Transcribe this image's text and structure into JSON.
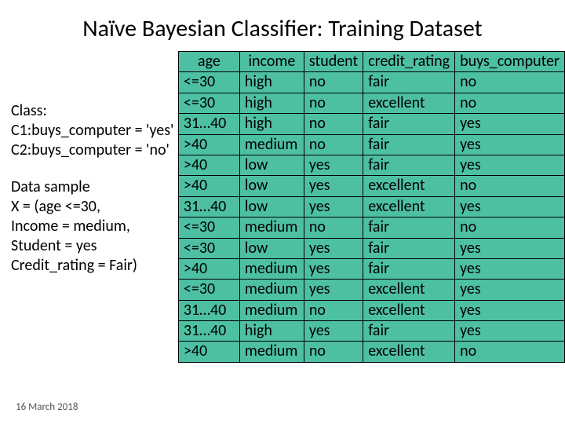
{
  "title": "Naïve Bayesian Classifier: Training Dataset",
  "left": {
    "class_heading": "Class:",
    "class_c1": "C1:buys_computer = 'yes'",
    "class_c2": "C2:buys_computer = 'no'",
    "sample_heading": "Data sample",
    "sample_l1": "X = (age <=30,",
    "sample_l2": "Income = medium,",
    "sample_l3": "Student = yes",
    "sample_l4": "Credit_rating = Fair)"
  },
  "date": "16 March 2018",
  "table": {
    "headers": {
      "age": "age",
      "income": "income",
      "student": "student",
      "credit": "credit_rating",
      "buys": "buys_computer"
    },
    "rows": [
      {
        "age": "<=30",
        "income": "high",
        "student": "no",
        "credit": "fair",
        "buys": "no"
      },
      {
        "age": "<=30",
        "income": "high",
        "student": "no",
        "credit": "excellent",
        "buys": "no"
      },
      {
        "age": "31…40",
        "income": "high",
        "student": "no",
        "credit": "fair",
        "buys": "yes"
      },
      {
        "age": ">40",
        "income": "medium",
        "student": "no",
        "credit": "fair",
        "buys": "yes"
      },
      {
        "age": ">40",
        "income": "low",
        "student": "yes",
        "credit": "fair",
        "buys": "yes"
      },
      {
        "age": ">40",
        "income": "low",
        "student": "yes",
        "credit": "excellent",
        "buys": "no"
      },
      {
        "age": "31…40",
        "income": "low",
        "student": "yes",
        "credit": "excellent",
        "buys": "yes"
      },
      {
        "age": "<=30",
        "income": "medium",
        "student": "no",
        "credit": "fair",
        "buys": "no"
      },
      {
        "age": "<=30",
        "income": "low",
        "student": "yes",
        "credit": "fair",
        "buys": "yes"
      },
      {
        "age": ">40",
        "income": "medium",
        "student": "yes",
        "credit": "fair",
        "buys": "yes"
      },
      {
        "age": "<=30",
        "income": "medium",
        "student": "yes",
        "credit": "excellent",
        "buys": "yes"
      },
      {
        "age": "31…40",
        "income": "medium",
        "student": "no",
        "credit": "excellent",
        "buys": "yes"
      },
      {
        "age": "31…40",
        "income": "high",
        "student": "yes",
        "credit": "fair",
        "buys": "yes"
      },
      {
        "age": ">40",
        "income": "medium",
        "student": "no",
        "credit": "excellent",
        "buys": "no"
      }
    ]
  }
}
